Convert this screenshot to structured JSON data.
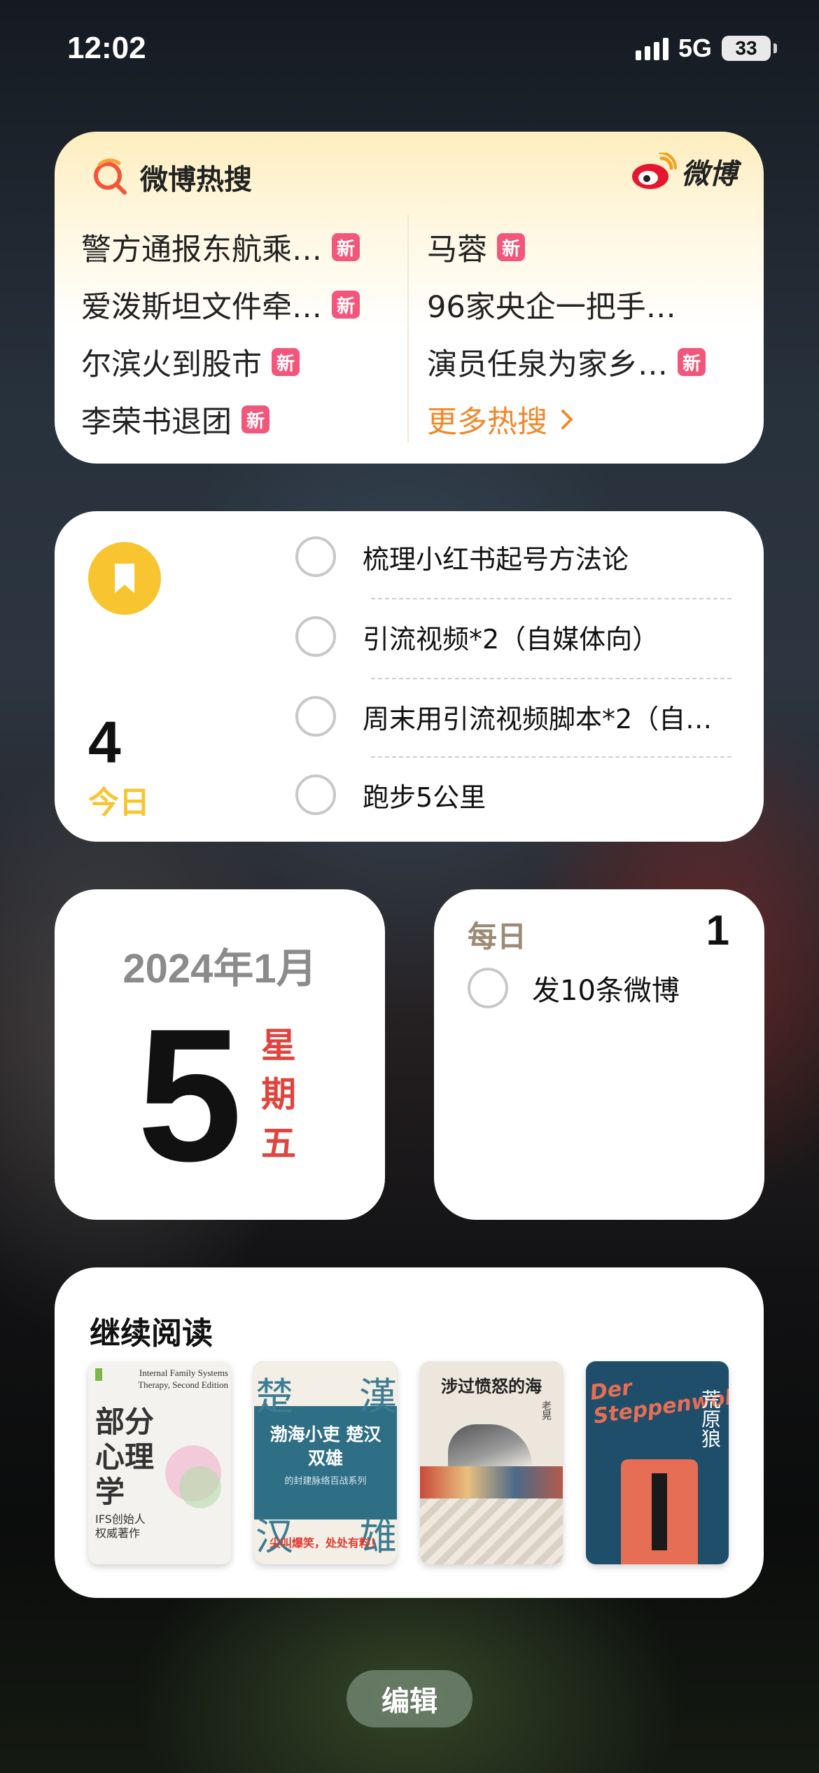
{
  "status_bar": {
    "time": "12:02",
    "network": "5G",
    "battery": "33"
  },
  "weibo_widget": {
    "title": "微博热搜",
    "brand": "微博",
    "badge": "新",
    "left_items": [
      {
        "text": "警方通报东航乘…",
        "new": true
      },
      {
        "text": "爱泼斯坦文件牵…",
        "new": true
      },
      {
        "text": "尔滨火到股市",
        "new": true
      },
      {
        "text": "李荣书退团",
        "new": true
      }
    ],
    "right_items": [
      {
        "text": "马蓉",
        "new": true
      },
      {
        "text": "96家央企一把手…",
        "new": false
      },
      {
        "text": "演员任泉为家乡…",
        "new": true
      }
    ],
    "more_label": "更多热搜",
    "colors": {
      "badge": "#f2577b",
      "more": "#f0882a"
    }
  },
  "reminders_widget": {
    "count": "4",
    "list_name": "今日",
    "icon": "bookmark-icon",
    "items": [
      "梳理小红书起号方法论",
      "引流视频*2（自媒体向）",
      "周末用引流视频脚本*2（自…",
      "跑步5公里"
    ],
    "colors": {
      "accent": "#f8c531"
    }
  },
  "calendar_widget": {
    "year_month": "2024年1月",
    "day": "5",
    "weekday_chars": [
      "星",
      "期",
      "五"
    ],
    "colors": {
      "weekday": "#e0443c"
    }
  },
  "daily_widget": {
    "title": "每日",
    "count": "1",
    "items": [
      "发10条微博"
    ]
  },
  "reading_widget": {
    "title": "继续阅读",
    "books": [
      {
        "title": "部分心理学",
        "en": "Internal Family Systems Therapy, Second Edition",
        "tag": "IFS创始人 权威著作"
      },
      {
        "title": "渤海小吏 楚汉双雄",
        "subtitle": "的封建脉络百战系列",
        "slogan": "尖叫爆笑，处处有料！",
        "big": [
          "楚",
          "漢",
          "汉",
          "雄"
        ]
      },
      {
        "title": "涉过愤怒的海",
        "author": "老晃"
      },
      {
        "title": "荒原狼",
        "de": "Der Steppenwolf"
      }
    ]
  },
  "edit_button": {
    "label": "编辑"
  }
}
